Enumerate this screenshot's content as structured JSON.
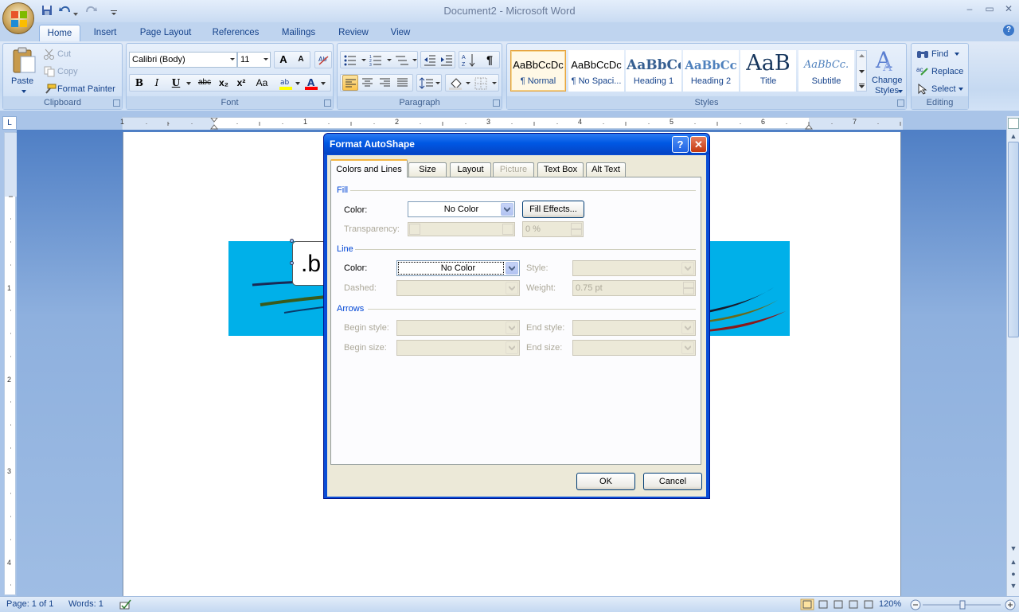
{
  "window": {
    "title": "Document2 - Microsoft Word",
    "minimize_glyph": "–",
    "restore_glyph": "▭",
    "close_glyph": "✕",
    "help_glyph": "?"
  },
  "ribbon": {
    "tabs": [
      "Home",
      "Insert",
      "Page Layout",
      "References",
      "Mailings",
      "Review",
      "View"
    ],
    "active_tab": "Home",
    "clipboard": {
      "label": "Clipboard",
      "paste": "Paste",
      "cut": "Cut",
      "copy": "Copy",
      "format_painter": "Format Painter"
    },
    "font": {
      "label": "Font",
      "family": "Calibri (Body)",
      "size": "11",
      "bold": "B",
      "italic": "I",
      "underline": "U",
      "strike": "abc",
      "sub": "x₂",
      "sup": "x²",
      "case": "Aa",
      "grow": "A",
      "shrink": "A",
      "highlight_color": "#ffff00",
      "font_color": "#ff0000"
    },
    "paragraph": {
      "label": "Paragraph",
      "pilcrow": "¶"
    },
    "styles": {
      "label": "Styles",
      "items": [
        {
          "sample": "AaBbCcDc",
          "name": "¶ Normal"
        },
        {
          "sample": "AaBbCcDc",
          "name": "¶ No Spaci..."
        },
        {
          "sample": "AaBbCc",
          "name": "Heading 1"
        },
        {
          "sample": "AaBbCc",
          "name": "Heading 2"
        },
        {
          "sample": "AaB",
          "name": "Title"
        },
        {
          "sample": "AaBbCc.",
          "name": "Subtitle"
        }
      ],
      "selected": "¶ Normal",
      "change_styles_line1": "Change",
      "change_styles_line2": "Styles"
    },
    "editing": {
      "label": "Editing",
      "find": "Find",
      "replace": "Replace",
      "select": "Select"
    }
  },
  "ruler": {
    "tab_selector": "L",
    "h_numbers": [
      "1",
      "1",
      "2",
      "3",
      "4",
      "5",
      "6",
      "7"
    ],
    "v_numbers": [
      "1",
      "2",
      "3",
      "4"
    ]
  },
  "document": {
    "textbox_text": ".b",
    "banner_color": "#00b0e9"
  },
  "dialog": {
    "title": "Format AutoShape",
    "tabs": [
      {
        "label": "Colors and Lines",
        "active": true,
        "enabled": true
      },
      {
        "label": "Size",
        "active": false,
        "enabled": true
      },
      {
        "label": "Layout",
        "active": false,
        "enabled": true
      },
      {
        "label": "Picture",
        "active": false,
        "enabled": false
      },
      {
        "label": "Text Box",
        "active": false,
        "enabled": true
      },
      {
        "label": "Alt Text",
        "active": false,
        "enabled": true
      }
    ],
    "fill": {
      "section": "Fill",
      "color_label": "Color:",
      "color_value": "No Color",
      "fill_effects": "Fill Effects...",
      "transparency_label": "Transparency:",
      "transparency_value": "0 %"
    },
    "line": {
      "section": "Line",
      "color_label": "Color:",
      "color_value": "No Color",
      "style_label": "Style:",
      "dashed_label": "Dashed:",
      "weight_label": "Weight:",
      "weight_value": "0.75 pt"
    },
    "arrows": {
      "section": "Arrows",
      "begin_style": "Begin style:",
      "end_style": "End style:",
      "begin_size": "Begin size:",
      "end_size": "End size:"
    },
    "ok": "OK",
    "cancel": "Cancel"
  },
  "status": {
    "page": "Page: 1 of 1",
    "words": "Words: 1",
    "zoom": "120%"
  }
}
